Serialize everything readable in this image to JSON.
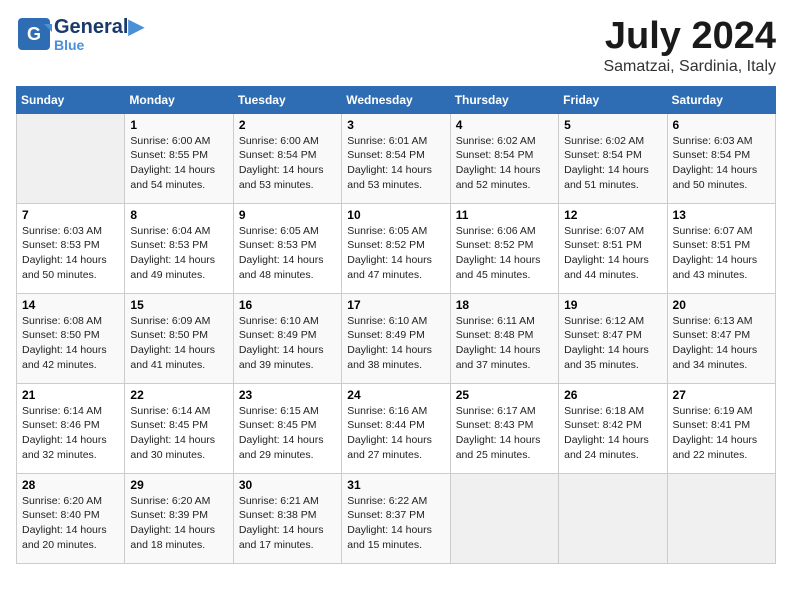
{
  "header": {
    "logo_line1": "General",
    "logo_line2": "Blue",
    "month_year": "July 2024",
    "location": "Samatzai, Sardinia, Italy"
  },
  "calendar": {
    "days_of_week": [
      "Sunday",
      "Monday",
      "Tuesday",
      "Wednesday",
      "Thursday",
      "Friday",
      "Saturday"
    ],
    "weeks": [
      [
        {
          "day": "",
          "info": ""
        },
        {
          "day": "1",
          "info": "Sunrise: 6:00 AM\nSunset: 8:55 PM\nDaylight: 14 hours\nand 54 minutes."
        },
        {
          "day": "2",
          "info": "Sunrise: 6:00 AM\nSunset: 8:54 PM\nDaylight: 14 hours\nand 53 minutes."
        },
        {
          "day": "3",
          "info": "Sunrise: 6:01 AM\nSunset: 8:54 PM\nDaylight: 14 hours\nand 53 minutes."
        },
        {
          "day": "4",
          "info": "Sunrise: 6:02 AM\nSunset: 8:54 PM\nDaylight: 14 hours\nand 52 minutes."
        },
        {
          "day": "5",
          "info": "Sunrise: 6:02 AM\nSunset: 8:54 PM\nDaylight: 14 hours\nand 51 minutes."
        },
        {
          "day": "6",
          "info": "Sunrise: 6:03 AM\nSunset: 8:54 PM\nDaylight: 14 hours\nand 50 minutes."
        }
      ],
      [
        {
          "day": "7",
          "info": "Sunrise: 6:03 AM\nSunset: 8:53 PM\nDaylight: 14 hours\nand 50 minutes."
        },
        {
          "day": "8",
          "info": "Sunrise: 6:04 AM\nSunset: 8:53 PM\nDaylight: 14 hours\nand 49 minutes."
        },
        {
          "day": "9",
          "info": "Sunrise: 6:05 AM\nSunset: 8:53 PM\nDaylight: 14 hours\nand 48 minutes."
        },
        {
          "day": "10",
          "info": "Sunrise: 6:05 AM\nSunset: 8:52 PM\nDaylight: 14 hours\nand 47 minutes."
        },
        {
          "day": "11",
          "info": "Sunrise: 6:06 AM\nSunset: 8:52 PM\nDaylight: 14 hours\nand 45 minutes."
        },
        {
          "day": "12",
          "info": "Sunrise: 6:07 AM\nSunset: 8:51 PM\nDaylight: 14 hours\nand 44 minutes."
        },
        {
          "day": "13",
          "info": "Sunrise: 6:07 AM\nSunset: 8:51 PM\nDaylight: 14 hours\nand 43 minutes."
        }
      ],
      [
        {
          "day": "14",
          "info": "Sunrise: 6:08 AM\nSunset: 8:50 PM\nDaylight: 14 hours\nand 42 minutes."
        },
        {
          "day": "15",
          "info": "Sunrise: 6:09 AM\nSunset: 8:50 PM\nDaylight: 14 hours\nand 41 minutes."
        },
        {
          "day": "16",
          "info": "Sunrise: 6:10 AM\nSunset: 8:49 PM\nDaylight: 14 hours\nand 39 minutes."
        },
        {
          "day": "17",
          "info": "Sunrise: 6:10 AM\nSunset: 8:49 PM\nDaylight: 14 hours\nand 38 minutes."
        },
        {
          "day": "18",
          "info": "Sunrise: 6:11 AM\nSunset: 8:48 PM\nDaylight: 14 hours\nand 37 minutes."
        },
        {
          "day": "19",
          "info": "Sunrise: 6:12 AM\nSunset: 8:47 PM\nDaylight: 14 hours\nand 35 minutes."
        },
        {
          "day": "20",
          "info": "Sunrise: 6:13 AM\nSunset: 8:47 PM\nDaylight: 14 hours\nand 34 minutes."
        }
      ],
      [
        {
          "day": "21",
          "info": "Sunrise: 6:14 AM\nSunset: 8:46 PM\nDaylight: 14 hours\nand 32 minutes."
        },
        {
          "day": "22",
          "info": "Sunrise: 6:14 AM\nSunset: 8:45 PM\nDaylight: 14 hours\nand 30 minutes."
        },
        {
          "day": "23",
          "info": "Sunrise: 6:15 AM\nSunset: 8:45 PM\nDaylight: 14 hours\nand 29 minutes."
        },
        {
          "day": "24",
          "info": "Sunrise: 6:16 AM\nSunset: 8:44 PM\nDaylight: 14 hours\nand 27 minutes."
        },
        {
          "day": "25",
          "info": "Sunrise: 6:17 AM\nSunset: 8:43 PM\nDaylight: 14 hours\nand 25 minutes."
        },
        {
          "day": "26",
          "info": "Sunrise: 6:18 AM\nSunset: 8:42 PM\nDaylight: 14 hours\nand 24 minutes."
        },
        {
          "day": "27",
          "info": "Sunrise: 6:19 AM\nSunset: 8:41 PM\nDaylight: 14 hours\nand 22 minutes."
        }
      ],
      [
        {
          "day": "28",
          "info": "Sunrise: 6:20 AM\nSunset: 8:40 PM\nDaylight: 14 hours\nand 20 minutes."
        },
        {
          "day": "29",
          "info": "Sunrise: 6:20 AM\nSunset: 8:39 PM\nDaylight: 14 hours\nand 18 minutes."
        },
        {
          "day": "30",
          "info": "Sunrise: 6:21 AM\nSunset: 8:38 PM\nDaylight: 14 hours\nand 17 minutes."
        },
        {
          "day": "31",
          "info": "Sunrise: 6:22 AM\nSunset: 8:37 PM\nDaylight: 14 hours\nand 15 minutes."
        },
        {
          "day": "",
          "info": ""
        },
        {
          "day": "",
          "info": ""
        },
        {
          "day": "",
          "info": ""
        }
      ]
    ]
  }
}
